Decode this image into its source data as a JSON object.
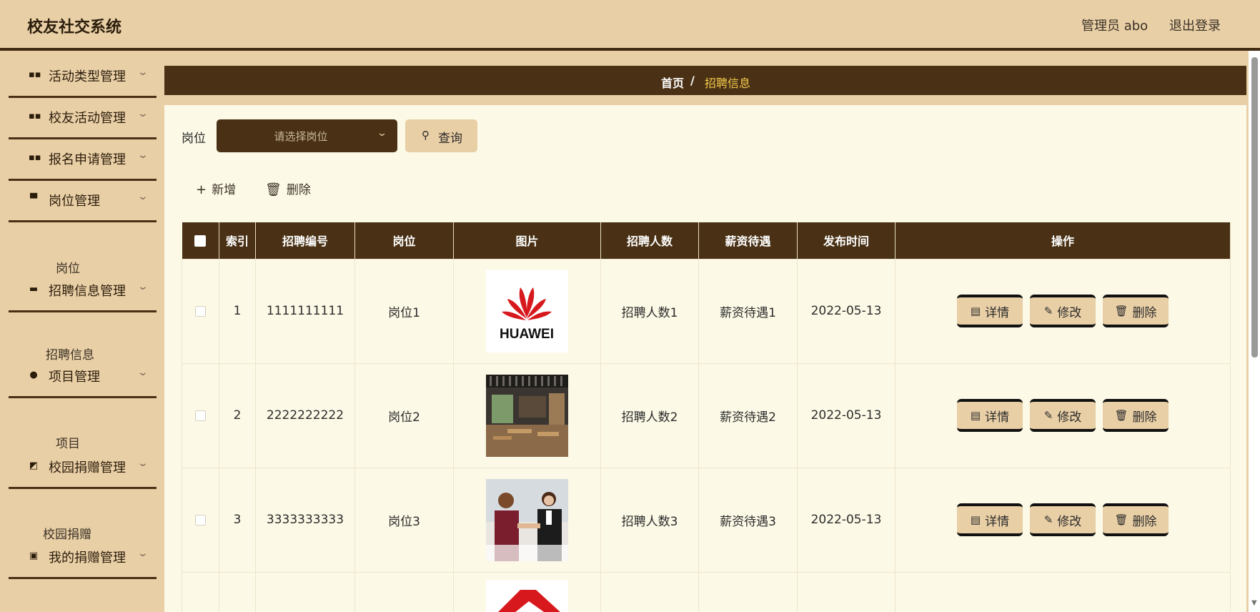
{
  "app": {
    "title": "校友社交系统",
    "user": "管理员 abo",
    "logout": "退出登录"
  },
  "sidebar": {
    "items": [
      {
        "label": "活动类型管理",
        "icon": "grid-icon"
      },
      {
        "label": "校友活动管理",
        "icon": "grid-icon"
      },
      {
        "label": "报名申请管理",
        "icon": "grid-icon"
      },
      {
        "label": "岗位管理",
        "icon": "flag-icon",
        "sub": "岗位"
      },
      {
        "label": "招聘信息管理",
        "icon": "monitor-icon",
        "sub": "招聘信息"
      },
      {
        "label": "项目管理",
        "icon": "user-icon",
        "sub": "项目"
      },
      {
        "label": "校园捐赠管理",
        "icon": "chart-icon",
        "sub": "校园捐赠"
      },
      {
        "label": "我的捐赠管理",
        "icon": "clipboard-icon"
      }
    ]
  },
  "breadcrumb": {
    "home": "首页",
    "separator": "/",
    "current": "招聘信息"
  },
  "search": {
    "label": "岗位",
    "placeholder": "请选择岗位",
    "query_button": "查询"
  },
  "toolbar": {
    "add": "新增",
    "delete": "删除"
  },
  "table": {
    "headers": [
      "索引",
      "招聘编号",
      "岗位",
      "图片",
      "招聘人数",
      "薪资待遇",
      "发布时间",
      "操作"
    ],
    "rows": [
      {
        "index": "1",
        "code": "1111111111",
        "position": "岗位1",
        "image": "huawei-logo",
        "count": "招聘人数1",
        "salary": "薪资待遇1",
        "date": "2022-05-13"
      },
      {
        "index": "2",
        "code": "2222222222",
        "position": "岗位2",
        "image": "office-photo",
        "count": "招聘人数2",
        "salary": "薪资待遇2",
        "date": "2022-05-13"
      },
      {
        "index": "3",
        "code": "3333333333",
        "position": "岗位3",
        "image": "handshake-photo",
        "count": "招聘人数3",
        "salary": "薪资待遇3",
        "date": "2022-05-13"
      }
    ],
    "actions": {
      "detail": "详情",
      "edit": "修改",
      "delete": "删除"
    }
  },
  "colors": {
    "accent_dark": "#4a3115",
    "accent_light": "#e9cfa6",
    "content_bg": "#fcf9e6",
    "breadcrumb_current": "#f2c94c"
  }
}
